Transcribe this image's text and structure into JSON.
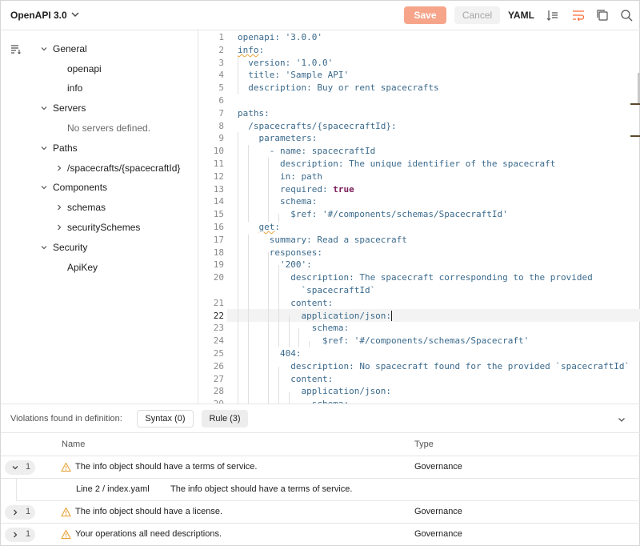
{
  "header": {
    "title": "OpenAPI 3.0",
    "save_label": "Save",
    "cancel_label": "Cancel",
    "format_label": "YAML"
  },
  "sidebar": {
    "items": [
      {
        "label": "General",
        "kind": "section",
        "expanded": true
      },
      {
        "label": "openapi",
        "kind": "leaf"
      },
      {
        "label": "info",
        "kind": "leaf"
      },
      {
        "label": "Servers",
        "kind": "section",
        "expanded": true
      },
      {
        "label": "No servers defined.",
        "kind": "empty"
      },
      {
        "label": "Paths",
        "kind": "section",
        "expanded": true
      },
      {
        "label": "/spacecrafts/{spacecraftId}",
        "kind": "collapsed"
      },
      {
        "label": "Components",
        "kind": "section",
        "expanded": true
      },
      {
        "label": "schemas",
        "kind": "collapsed"
      },
      {
        "label": "securitySchemes",
        "kind": "collapsed"
      },
      {
        "label": "Security",
        "kind": "section",
        "expanded": true
      },
      {
        "label": "ApiKey",
        "kind": "leaf"
      }
    ]
  },
  "editor": {
    "active_line": 22,
    "lines": [
      {
        "n": "1",
        "text": "openapi: '3.0.0'"
      },
      {
        "n": "2",
        "text": "info:"
      },
      {
        "n": "3",
        "text": "  version: '1.0.0'"
      },
      {
        "n": "4",
        "text": "  title: 'Sample API'"
      },
      {
        "n": "5",
        "text": "  description: Buy or rent spacecrafts"
      },
      {
        "n": "6",
        "text": ""
      },
      {
        "n": "7",
        "text": "paths:"
      },
      {
        "n": "8",
        "text": "  /spacecrafts/{spacecraftId}:"
      },
      {
        "n": "9",
        "text": "    parameters:"
      },
      {
        "n": "10",
        "text": "      - name: spacecraftId"
      },
      {
        "n": "11",
        "text": "        description: The unique identifier of the spacecraft"
      },
      {
        "n": "12",
        "text": "        in: path"
      },
      {
        "n": "13",
        "text": "        required: true"
      },
      {
        "n": "14",
        "text": "        schema:"
      },
      {
        "n": "15",
        "text": "          $ref: '#/components/schemas/SpacecraftId'"
      },
      {
        "n": "16",
        "text": "    get:"
      },
      {
        "n": "17",
        "text": "      summary: Read a spacecraft"
      },
      {
        "n": "18",
        "text": "      responses:"
      },
      {
        "n": "19",
        "text": "        '200':"
      },
      {
        "n": "20",
        "text": "          description: The spacecraft corresponding to the provided"
      },
      {
        "n": "",
        "text": "            `spacecraftId`"
      },
      {
        "n": "21",
        "text": "          content:"
      },
      {
        "n": "22",
        "text": "            application/json:"
      },
      {
        "n": "23",
        "text": "              schema:"
      },
      {
        "n": "24",
        "text": "                $ref: '#/components/schemas/Spacecraft'"
      },
      {
        "n": "25",
        "text": "        404:"
      },
      {
        "n": "26",
        "text": "          description: No spacecraft found for the provided `spacecraftId`"
      },
      {
        "n": "27",
        "text": "          content:"
      },
      {
        "n": "28",
        "text": "            application/json:"
      },
      {
        "n": "29",
        "text": "              schema:"
      }
    ]
  },
  "violations": {
    "label": "Violations found in definition:",
    "syntax_label": "Syntax (0)",
    "rule_label": "Rule (3)",
    "columns": {
      "name": "Name",
      "type": "Type"
    },
    "rows": [
      {
        "count": "1",
        "name": "The info object should have a terms of service.",
        "type": "Governance",
        "expanded": true
      },
      {
        "count": "1",
        "name": "The info object should have a license.",
        "type": "Governance",
        "expanded": false
      },
      {
        "count": "1",
        "name": "Your operations all need descriptions.",
        "type": "Governance",
        "expanded": false
      }
    ],
    "detail": {
      "location": "Line 2 / index.yaml",
      "message": "The info object should have a terms of service."
    }
  },
  "colors": {
    "save_bg": "#f6a58b",
    "accent": "#ff6c37",
    "warning": "#e8a33a",
    "code_key": "#3b6a8c",
    "code_bool": "#7a1f5a"
  },
  "icons": [
    "chevron-down-icon",
    "beautify-icon",
    "wrap-lines-icon",
    "copy-icon",
    "search-icon",
    "outline-icon",
    "chevron-right-icon",
    "warning-icon"
  ]
}
